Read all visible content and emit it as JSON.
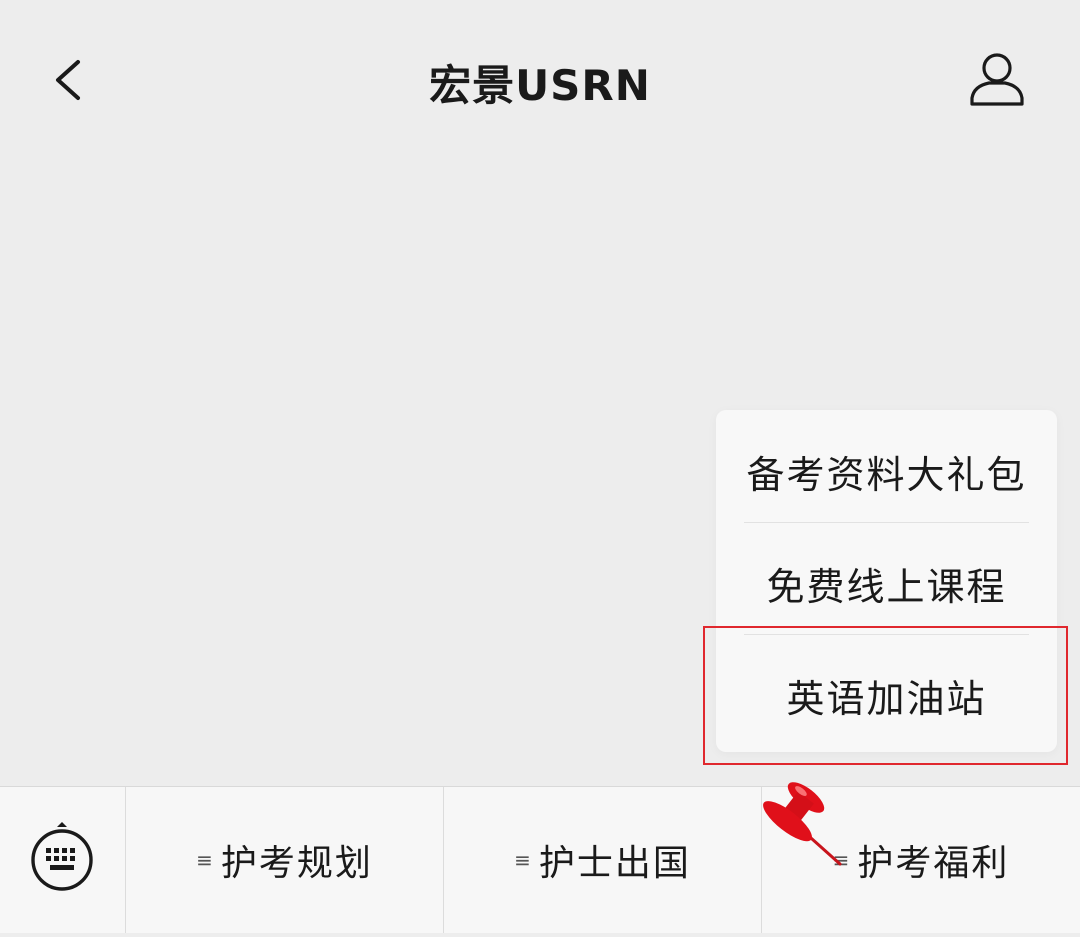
{
  "header": {
    "title": "宏景USRN",
    "back_icon": "chevron-left-icon",
    "profile_icon": "person-icon"
  },
  "popup_menu": {
    "items": [
      {
        "label": "备考资料大礼包"
      },
      {
        "label": "免费线上课程"
      },
      {
        "label": "英语加油站",
        "highlighted": true
      }
    ]
  },
  "bottom_menu": {
    "keyboard_icon": "keyboard-icon",
    "menu_glyph": "≡",
    "items": [
      {
        "label": "护考规划"
      },
      {
        "label": "护士出国"
      },
      {
        "label": "护考福利",
        "active": true
      }
    ]
  },
  "annotation": {
    "highlight_color": "#e0282e",
    "pin_icon": "push-pin-icon"
  }
}
